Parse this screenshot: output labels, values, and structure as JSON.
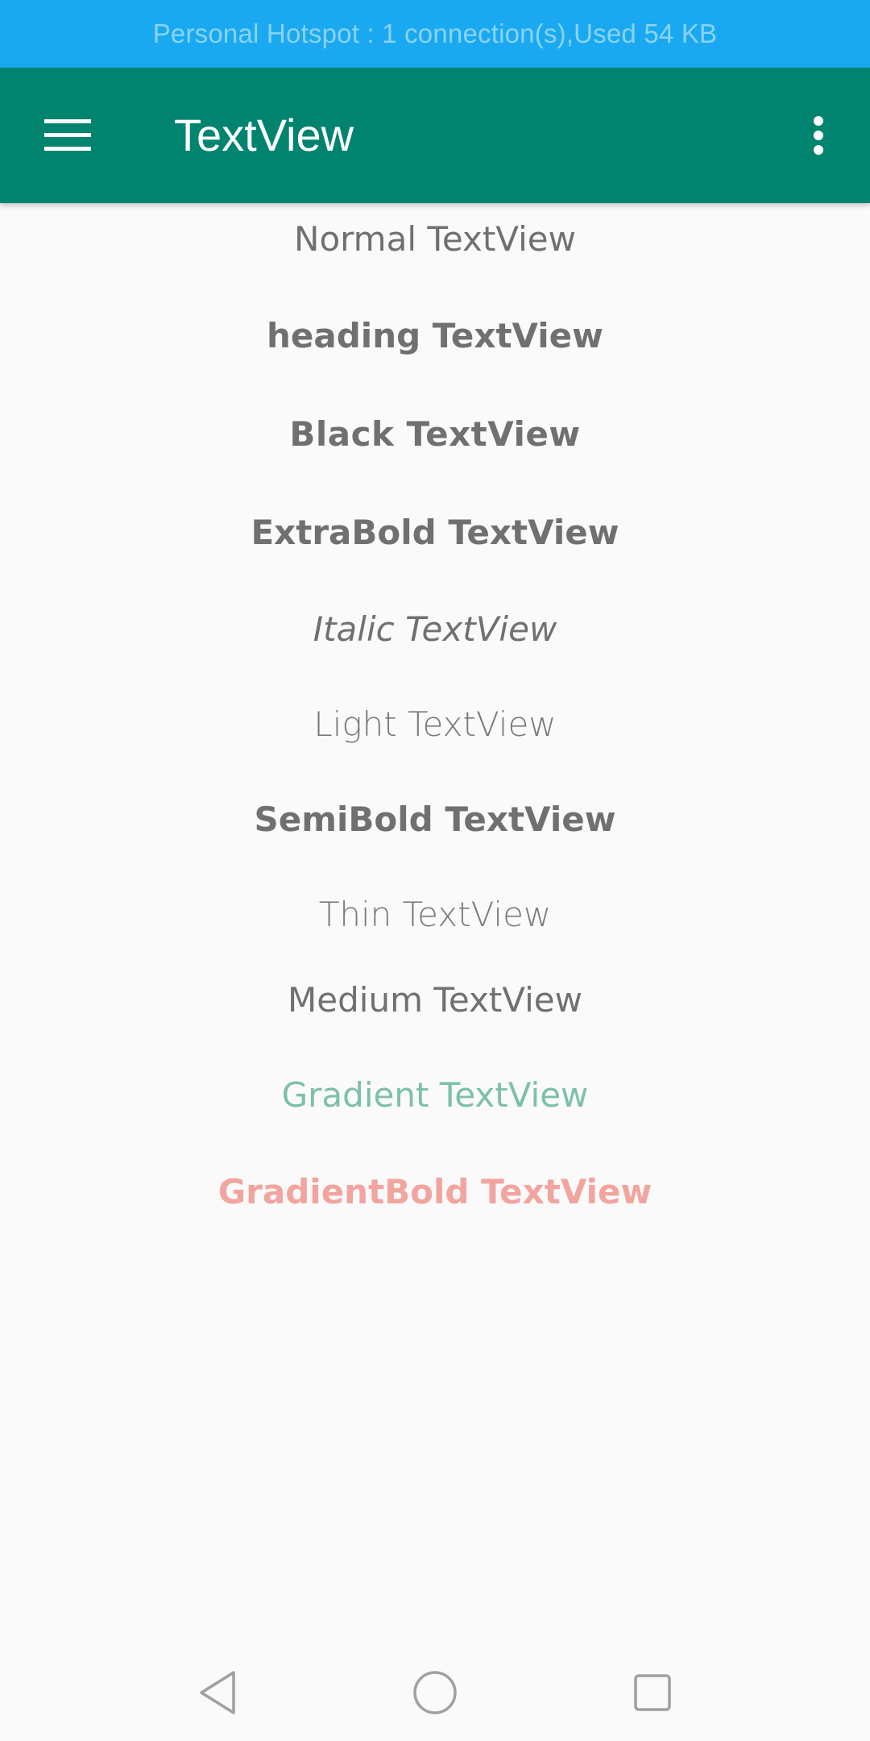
{
  "status_bar": {
    "hotspot_text": "Personal Hotspot : 1 connection(s),Used  54 KB"
  },
  "app_bar": {
    "title": "TextView",
    "menu_icon": "hamburger-menu-icon",
    "overflow_icon": "more-vert-icon"
  },
  "text_views": [
    {
      "label": "Normal TextView"
    },
    {
      "label": "heading TextView"
    },
    {
      "label": "Black TextView"
    },
    {
      "label": "ExtraBold TextView"
    },
    {
      "label": "Italic TextView"
    },
    {
      "label": "Light TextView"
    },
    {
      "label": "SemiBold TextView"
    },
    {
      "label": "Thin TextView"
    },
    {
      "label": "Medium TextView"
    },
    {
      "label": "Gradient TextView"
    },
    {
      "label": "GradientBold TextView"
    }
  ],
  "nav_bar": {
    "back_icon": "back-triangle-icon",
    "home_icon": "home-circle-icon",
    "recents_icon": "recents-square-icon"
  },
  "colors": {
    "status_bar": "#1aa9f0",
    "app_bar": "#00846f",
    "text": "#707070",
    "gradient_text": "#7dbfac",
    "gradient_bold_text": "#f2a49f"
  }
}
